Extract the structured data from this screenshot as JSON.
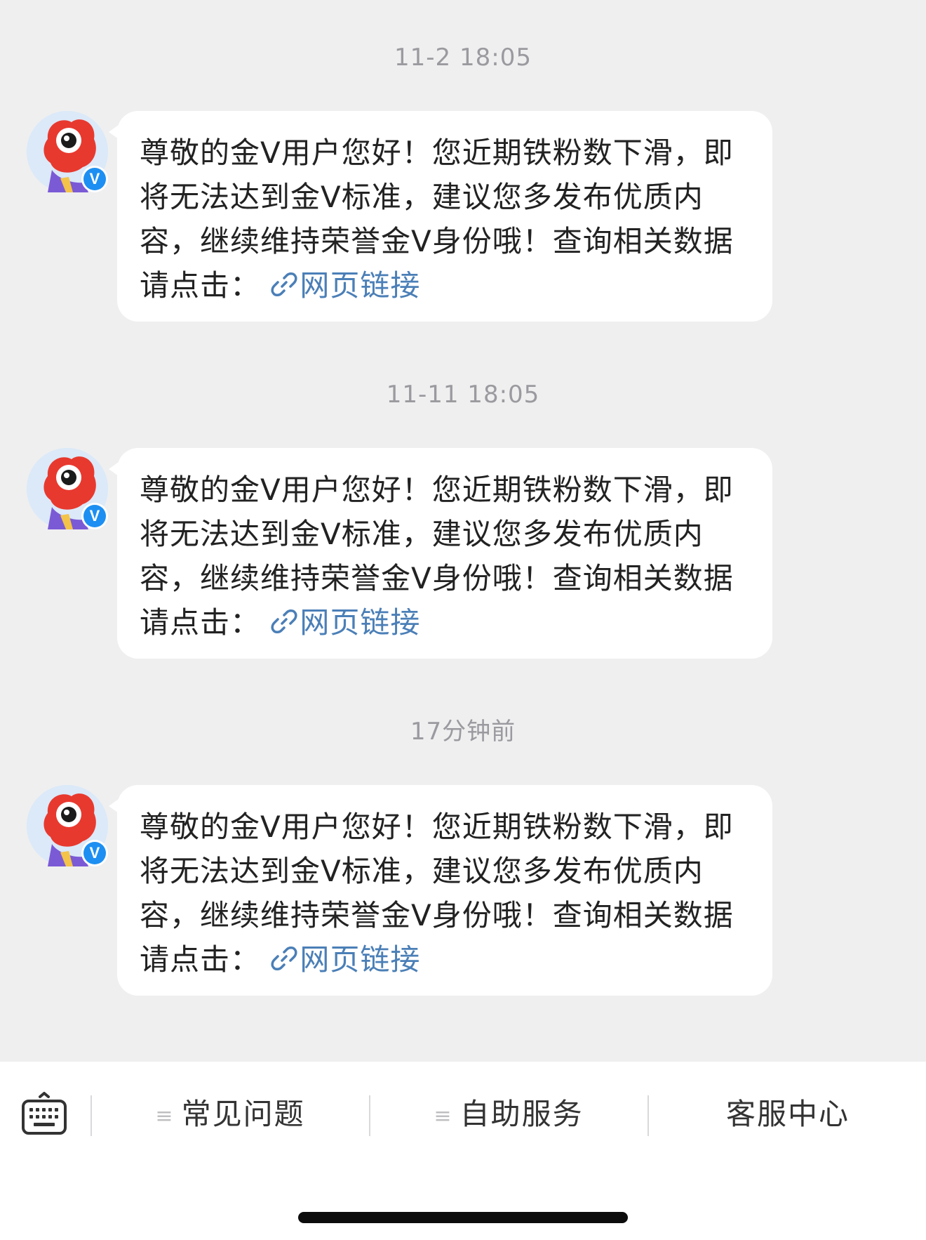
{
  "colors": {
    "background": "#efeff0",
    "bubble": "#ffffff",
    "text": "#222222",
    "link": "#4b7fb7",
    "timestamp": "#9a9a9f",
    "verified_badge": "#1d8ff2"
  },
  "messages": [
    {
      "timestamp": "11-2 18:05",
      "text": "尊敬的金V用户您好！您近期铁粉数下滑，即将无法达到金V标准，建议您多发布优质内容，继续维持荣誉金V身份哦！查询相关数据请点击：",
      "link_icon": "link-icon",
      "link_label": "网页链接",
      "badge": "V"
    },
    {
      "timestamp": "11-11 18:05",
      "text": "尊敬的金V用户您好！您近期铁粉数下滑，即将无法达到金V标准，建议您多发布优质内容，继续维持荣誉金V身份哦！查询相关数据请点击：",
      "link_icon": "link-icon",
      "link_label": "网页链接",
      "badge": "V"
    },
    {
      "timestamp": "17分钟前",
      "text": "尊敬的金V用户您好！您近期铁粉数下滑，即将无法达到金V标准，建议您多发布优质内容，继续维持荣誉金V身份哦！查询相关数据请点击：",
      "link_icon": "link-icon",
      "link_label": "网页链接",
      "badge": "V"
    }
  ],
  "bottom_bar": {
    "keyboard_icon": "keyboard-icon",
    "menu_icon": "menu-lines-icon",
    "items": [
      {
        "label": "常见问题",
        "has_menu_icon": true
      },
      {
        "label": "自助服务",
        "has_menu_icon": true
      },
      {
        "label": "客服中心",
        "has_menu_icon": false
      }
    ]
  }
}
